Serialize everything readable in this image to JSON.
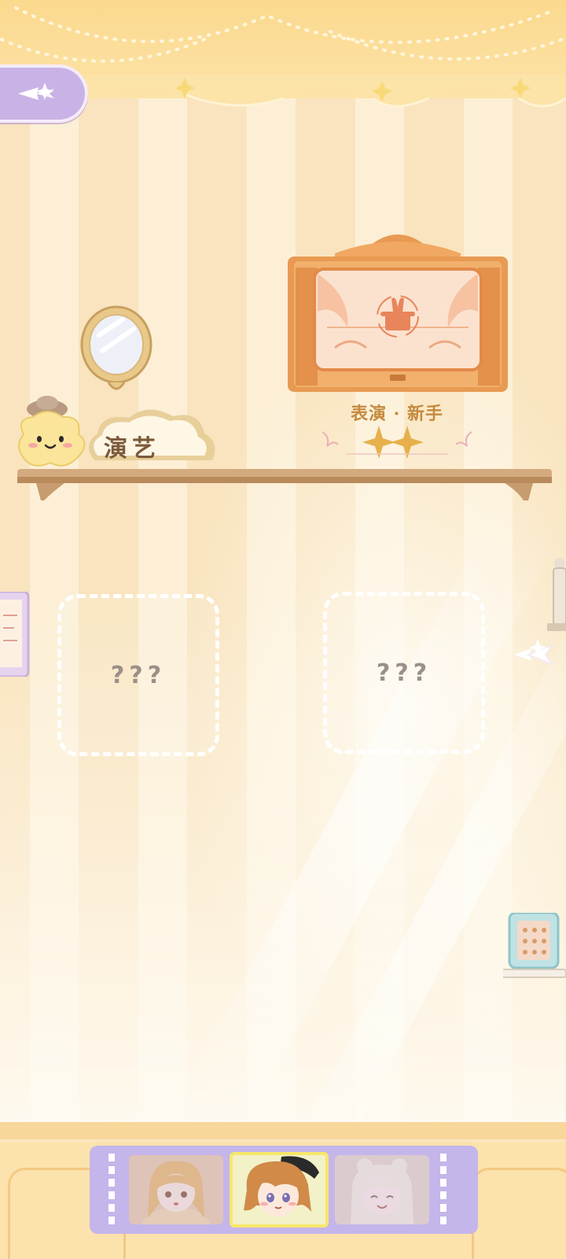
{
  "scene": {
    "back_button": {
      "icon": "back-arrow-icon"
    },
    "shelf_label": "演艺",
    "frame": {
      "title": "表演 · 新手",
      "star_count": 2,
      "icon": "magic-hat-rabbit-icon"
    },
    "slots": [
      {
        "text": "???"
      },
      {
        "text": "???"
      }
    ],
    "next_button": {
      "icon": "next-arrow-icon"
    }
  },
  "characters": [
    {
      "name": "blonde-girl-portrait",
      "selected": false
    },
    {
      "name": "brown-hair-beret-girl-portrait",
      "selected": true
    },
    {
      "name": "white-hair-girl-portrait",
      "selected": false
    }
  ],
  "colors": {
    "accent_purple": "#c4b5ea",
    "frame_orange": "#e89a52",
    "selected_border": "#f7e76a",
    "title_gold": "#c48a3d"
  }
}
